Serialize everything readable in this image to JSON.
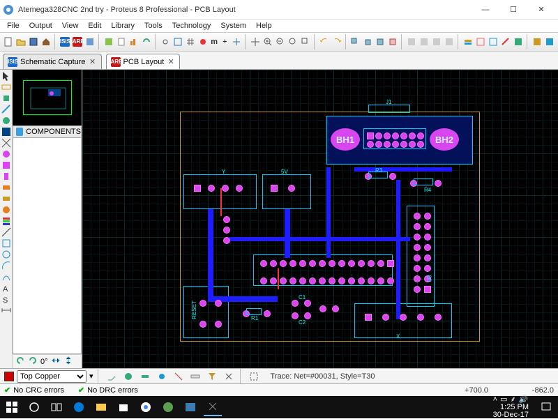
{
  "window": {
    "title": "Atemega328CNC 2nd try - Proteus 8 Professional - PCB Layout",
    "minimize": "—",
    "maximize": "☐",
    "close": "✕"
  },
  "menubar": [
    "File",
    "Output",
    "View",
    "Edit",
    "Library",
    "Tools",
    "Technology",
    "System",
    "Help"
  ],
  "tabs": {
    "schematic": "Schematic Capture",
    "pcb": "PCB Layout"
  },
  "sidepanel": {
    "header": "COMPONENTS"
  },
  "layerbar": {
    "layer": "Top Copper",
    "trace_info": "Trace: Net=#00031, Style=T30"
  },
  "statusbar": {
    "crc": "No CRC errors",
    "drc": "No DRC errors",
    "x": "+700.0",
    "y": "-862.0"
  },
  "rotation": {
    "angle": "0°"
  },
  "board": {
    "bh1": "BH1",
    "bh2": "BH2",
    "j1": "J1",
    "r3": "R3",
    "r4": "R4",
    "u3": "U3",
    "c1": "C1",
    "c2": "C2",
    "r1": "R1",
    "reset": "RESET",
    "x": "X",
    "y": "Y",
    "fiveV": "5V"
  },
  "taskbar": {
    "time": "1:25 PM",
    "date": "30-Dec-17"
  }
}
